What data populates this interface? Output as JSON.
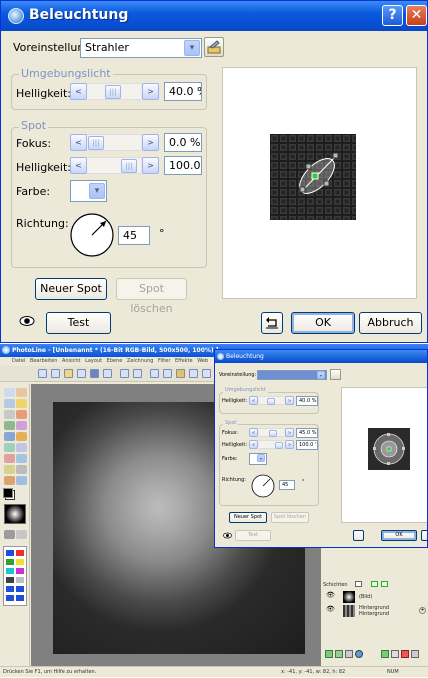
{
  "dialog": {
    "title": "Beleuchtung",
    "help_label": "?",
    "close_label": "✕",
    "preset_label": "Voreinstellung:",
    "preset_value": "Strahler",
    "ambient_group": "Umgebungslicht",
    "ambient_brightness_label": "Helligkeit:",
    "ambient_brightness_value": "40.0 %",
    "spot_group": "Spot",
    "focus_label": "Fokus:",
    "focus_value": "0.0 %",
    "spot_brightness_label": "Helligkeit:",
    "spot_brightness_value": "100.0 '",
    "color_label": "Farbe:",
    "direction_label": "Richtung:",
    "direction_value": "45",
    "degree_symbol": "°",
    "new_spot_label": "Neuer Spot",
    "delete_spot_label": "Spot löschen",
    "test_label": "Test",
    "ok_label": "OK",
    "cancel_label": "Abbruch",
    "slider_thumb_glyph": "|||",
    "arrow_left": "<",
    "arrow_right": ">",
    "combo_arrow": "▾"
  },
  "app": {
    "title": "PhotoLine - [Unbenannt * (16-Bit RGB-Bild, 500x500, 100%) ]",
    "menu": [
      "Datei",
      "Bearbeiten",
      "Ansicht",
      "Layout",
      "Ebene",
      "Zeichnung",
      "Filter",
      "Effekte",
      "Web"
    ],
    "status_left": "Drücken Sie F1, um Hilfe zu erhalten.",
    "status_coords": "x: -41, y: -41, w: 82, h: 82",
    "status_num": "NUM",
    "layers": [
      {
        "name": "(Bild)",
        "visible": true
      },
      {
        "name": "Hintergrund",
        "visible": true
      },
      {
        "name": "Hintergrund",
        "visible": false
      }
    ],
    "layers_tab_label": "Schichten"
  },
  "dialog_small": {
    "title": "Beleuchtung",
    "preset_label": "Voreinstellung:",
    "ambient_group": "Umgebungslicht",
    "ambient_brightness_label": "Helligkeit:",
    "ambient_brightness_value": "40.0 %",
    "spot_group": "Spot",
    "focus_label": "Fokus:",
    "focus_value": "45.0 %",
    "spot_brightness_label": "Helligkeit:",
    "spot_brightness_value": "100.0 '",
    "color_label": "Farbe:",
    "direction_label": "Richtung:",
    "direction_value": "45",
    "degree_symbol": "°",
    "new_spot_label": "Neuer Spot",
    "delete_spot_label": "Spot löschen",
    "test_label": "Test",
    "ok_label": "OK"
  },
  "colors": {
    "titlebar": "#0a5ae0",
    "dialog_bg": "#ece9d8",
    "group_title": "#7d93c6"
  }
}
